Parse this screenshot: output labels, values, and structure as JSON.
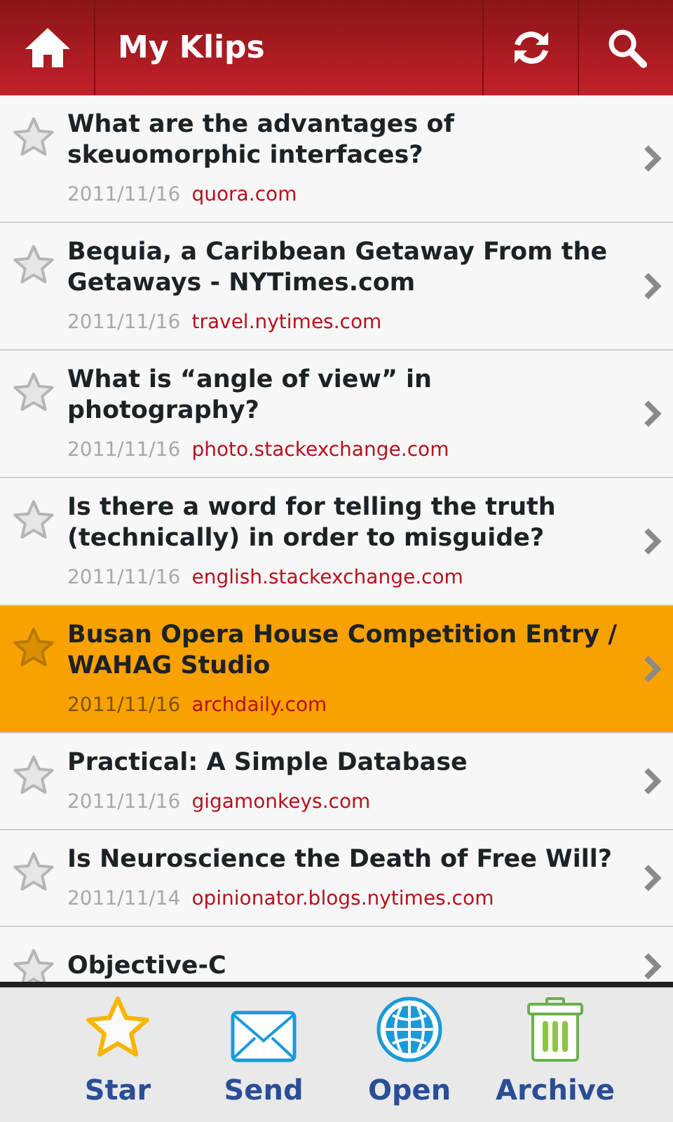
{
  "header": {
    "title": "My Klips"
  },
  "items": [
    {
      "title": "What are the advantages of skeuomorphic interfaces?",
      "date": "2011/11/16",
      "source": "quora.com",
      "selected": false
    },
    {
      "title": "Bequia, a Caribbean Getaway From the Getaways - NYTimes.com",
      "date": "2011/11/16",
      "source": "travel.nytimes.com",
      "selected": false
    },
    {
      "title": "What is “angle of view” in photography?",
      "date": "2011/11/16",
      "source": "photo.stackexchange.com",
      "selected": false
    },
    {
      "title": "Is there a word for telling the truth (technically) in order to misguide?",
      "date": "2011/11/16",
      "source": "english.stackexchange.com",
      "selected": false
    },
    {
      "title": "Busan Opera House Competition Entry / WAHAG Studio",
      "date": "2011/11/16",
      "source": "archdaily.com",
      "selected": true
    },
    {
      "title": "Practical: A Simple Database",
      "date": "2011/11/16",
      "source": "gigamonkeys.com",
      "selected": false
    },
    {
      "title": "Is Neuroscience the Death of Free Will?",
      "date": "2011/11/14",
      "source": "opinionator.blogs.nytimes.com",
      "selected": false
    },
    {
      "title": "Objective-C",
      "selected": false
    }
  ],
  "actions": [
    {
      "kind": "star",
      "label": "Star"
    },
    {
      "kind": "send",
      "label": "Send"
    },
    {
      "kind": "open",
      "label": "Open"
    },
    {
      "kind": "archive",
      "label": "Archive"
    }
  ]
}
